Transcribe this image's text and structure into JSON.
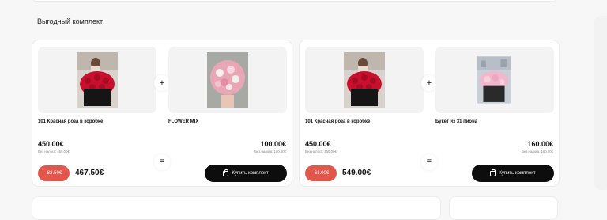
{
  "section": {
    "title": "Выгодный комплект"
  },
  "bundles": [
    {
      "products": [
        {
          "name": "101 Красная роза в коробке",
          "price": "450.00€",
          "net": "Без налога: 450.00€",
          "image": "red-roses-box"
        },
        {
          "name": "FLOWER MIX",
          "price": "100.00€",
          "net": "Без налога: 100.00€",
          "image": "mixed-bouquet"
        }
      ],
      "plus": "+",
      "equals": "=",
      "discount": "-82.50€",
      "total": "467.50€",
      "buy_label": "Купить комплект"
    },
    {
      "products": [
        {
          "name": "101 Красная роза в коробке",
          "price": "450.00€",
          "net": "Без налога: 450.00€",
          "image": "red-roses-box"
        },
        {
          "name": "Букет из 31 пиона",
          "price": "160.00€",
          "net": "Без налога: 160.00€",
          "image": "pink-peony-bouquet"
        }
      ],
      "plus": "+",
      "equals": "=",
      "discount": "-61.00€",
      "total": "549.00€",
      "buy_label": "Купить комплект"
    }
  ],
  "colors": {
    "discount": "#e2574c",
    "button": "#0d0d0d",
    "roses": "#c8102e"
  }
}
